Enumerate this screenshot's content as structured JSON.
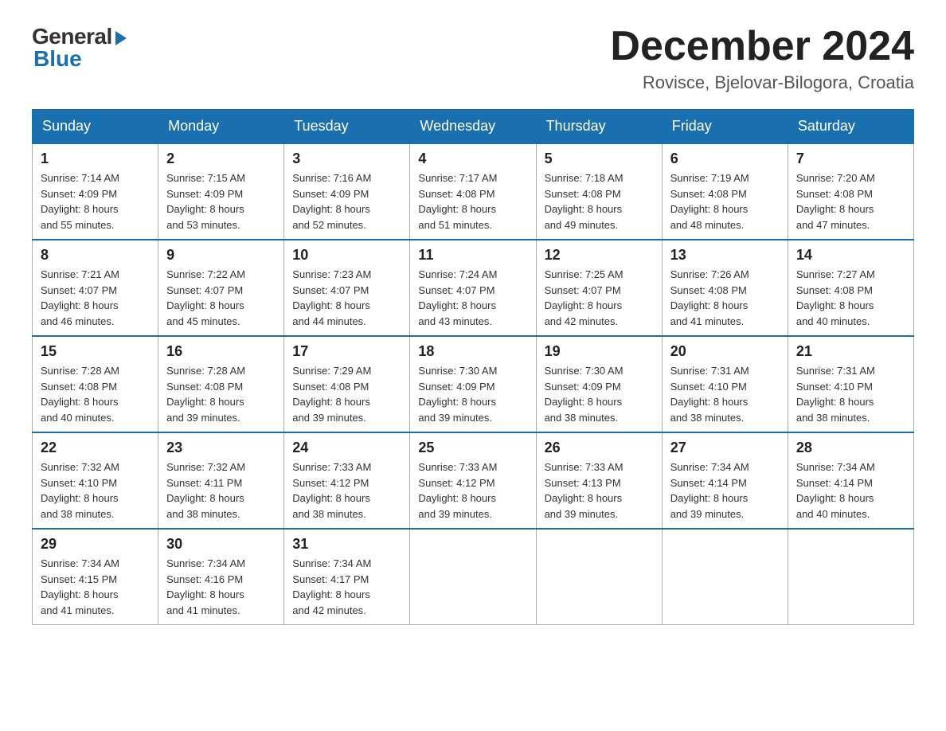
{
  "header": {
    "logo_general": "General",
    "logo_blue": "Blue",
    "month_title": "December 2024",
    "location": "Rovisce, Bjelovar-Bilogora, Croatia"
  },
  "days_of_week": [
    "Sunday",
    "Monday",
    "Tuesday",
    "Wednesday",
    "Thursday",
    "Friday",
    "Saturday"
  ],
  "weeks": [
    [
      {
        "day": "1",
        "sunrise": "7:14 AM",
        "sunset": "4:09 PM",
        "daylight": "8 hours and 55 minutes."
      },
      {
        "day": "2",
        "sunrise": "7:15 AM",
        "sunset": "4:09 PM",
        "daylight": "8 hours and 53 minutes."
      },
      {
        "day": "3",
        "sunrise": "7:16 AM",
        "sunset": "4:09 PM",
        "daylight": "8 hours and 52 minutes."
      },
      {
        "day": "4",
        "sunrise": "7:17 AM",
        "sunset": "4:08 PM",
        "daylight": "8 hours and 51 minutes."
      },
      {
        "day": "5",
        "sunrise": "7:18 AM",
        "sunset": "4:08 PM",
        "daylight": "8 hours and 49 minutes."
      },
      {
        "day": "6",
        "sunrise": "7:19 AM",
        "sunset": "4:08 PM",
        "daylight": "8 hours and 48 minutes."
      },
      {
        "day": "7",
        "sunrise": "7:20 AM",
        "sunset": "4:08 PM",
        "daylight": "8 hours and 47 minutes."
      }
    ],
    [
      {
        "day": "8",
        "sunrise": "7:21 AM",
        "sunset": "4:07 PM",
        "daylight": "8 hours and 46 minutes."
      },
      {
        "day": "9",
        "sunrise": "7:22 AM",
        "sunset": "4:07 PM",
        "daylight": "8 hours and 45 minutes."
      },
      {
        "day": "10",
        "sunrise": "7:23 AM",
        "sunset": "4:07 PM",
        "daylight": "8 hours and 44 minutes."
      },
      {
        "day": "11",
        "sunrise": "7:24 AM",
        "sunset": "4:07 PM",
        "daylight": "8 hours and 43 minutes."
      },
      {
        "day": "12",
        "sunrise": "7:25 AM",
        "sunset": "4:07 PM",
        "daylight": "8 hours and 42 minutes."
      },
      {
        "day": "13",
        "sunrise": "7:26 AM",
        "sunset": "4:08 PM",
        "daylight": "8 hours and 41 minutes."
      },
      {
        "day": "14",
        "sunrise": "7:27 AM",
        "sunset": "4:08 PM",
        "daylight": "8 hours and 40 minutes."
      }
    ],
    [
      {
        "day": "15",
        "sunrise": "7:28 AM",
        "sunset": "4:08 PM",
        "daylight": "8 hours and 40 minutes."
      },
      {
        "day": "16",
        "sunrise": "7:28 AM",
        "sunset": "4:08 PM",
        "daylight": "8 hours and 39 minutes."
      },
      {
        "day": "17",
        "sunrise": "7:29 AM",
        "sunset": "4:08 PM",
        "daylight": "8 hours and 39 minutes."
      },
      {
        "day": "18",
        "sunrise": "7:30 AM",
        "sunset": "4:09 PM",
        "daylight": "8 hours and 39 minutes."
      },
      {
        "day": "19",
        "sunrise": "7:30 AM",
        "sunset": "4:09 PM",
        "daylight": "8 hours and 38 minutes."
      },
      {
        "day": "20",
        "sunrise": "7:31 AM",
        "sunset": "4:10 PM",
        "daylight": "8 hours and 38 minutes."
      },
      {
        "day": "21",
        "sunrise": "7:31 AM",
        "sunset": "4:10 PM",
        "daylight": "8 hours and 38 minutes."
      }
    ],
    [
      {
        "day": "22",
        "sunrise": "7:32 AM",
        "sunset": "4:10 PM",
        "daylight": "8 hours and 38 minutes."
      },
      {
        "day": "23",
        "sunrise": "7:32 AM",
        "sunset": "4:11 PM",
        "daylight": "8 hours and 38 minutes."
      },
      {
        "day": "24",
        "sunrise": "7:33 AM",
        "sunset": "4:12 PM",
        "daylight": "8 hours and 38 minutes."
      },
      {
        "day": "25",
        "sunrise": "7:33 AM",
        "sunset": "4:12 PM",
        "daylight": "8 hours and 39 minutes."
      },
      {
        "day": "26",
        "sunrise": "7:33 AM",
        "sunset": "4:13 PM",
        "daylight": "8 hours and 39 minutes."
      },
      {
        "day": "27",
        "sunrise": "7:34 AM",
        "sunset": "4:14 PM",
        "daylight": "8 hours and 39 minutes."
      },
      {
        "day": "28",
        "sunrise": "7:34 AM",
        "sunset": "4:14 PM",
        "daylight": "8 hours and 40 minutes."
      }
    ],
    [
      {
        "day": "29",
        "sunrise": "7:34 AM",
        "sunset": "4:15 PM",
        "daylight": "8 hours and 41 minutes."
      },
      {
        "day": "30",
        "sunrise": "7:34 AM",
        "sunset": "4:16 PM",
        "daylight": "8 hours and 41 minutes."
      },
      {
        "day": "31",
        "sunrise": "7:34 AM",
        "sunset": "4:17 PM",
        "daylight": "8 hours and 42 minutes."
      },
      null,
      null,
      null,
      null
    ]
  ],
  "labels": {
    "sunrise_prefix": "Sunrise: ",
    "sunset_prefix": "Sunset: ",
    "daylight_prefix": "Daylight: "
  }
}
